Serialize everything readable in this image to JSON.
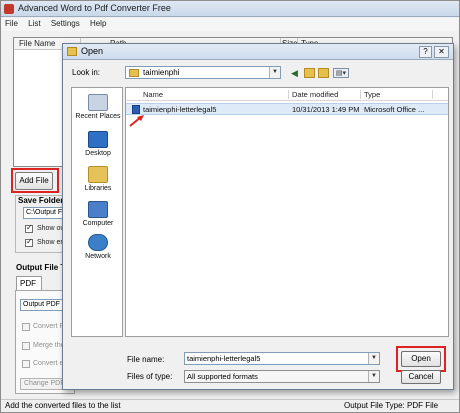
{
  "app": {
    "title": "Advanced Word to Pdf Converter Free",
    "menu": [
      "File",
      "List",
      "Settings",
      "Help"
    ],
    "list_columns": [
      "File Name",
      "Path",
      "Size",
      "Type"
    ],
    "add_file_label": "Add File",
    "save_folder_label": "Save Folder:",
    "save_folder_value": "C:\\Output Fil",
    "check_show_output": "Show ou",
    "check_show_error": "Show err",
    "output_file_type_label": "Output File Ty",
    "output_tab": "PDF",
    "output_select": "Output PDF as",
    "opt_convert_pdf": "Convert PF",
    "opt_merge": "Merge the",
    "opt_convert_each": "Convert ea",
    "change_pdf_label": "Change PDF",
    "status_message": "Add the converted files to the list",
    "status_right": "Output File Type:  PDF File"
  },
  "dialog": {
    "title": "Open",
    "help_label": "?",
    "close_label": "✕",
    "look_in_label": "Look in:",
    "look_in_value": "taimienphi",
    "places": [
      "Recent Places",
      "Desktop",
      "Libraries",
      "Computer",
      "Network"
    ],
    "columns": [
      "Name",
      "Date modified",
      "Type"
    ],
    "files": [
      {
        "name": "taimienphi-letterlegal5",
        "date": "10/31/2013 1:49 PM",
        "type": "Microsoft Office ..."
      }
    ],
    "file_name_label": "File name:",
    "file_name_value": "taimienphi-letterlegal5",
    "files_of_type_label": "Files of type:",
    "files_of_type_value": "All supported formats",
    "open_label": "Open",
    "cancel_label": "Cancel"
  },
  "colors": {
    "highlight": "#dd2222",
    "selection": "#dfeaf8"
  }
}
